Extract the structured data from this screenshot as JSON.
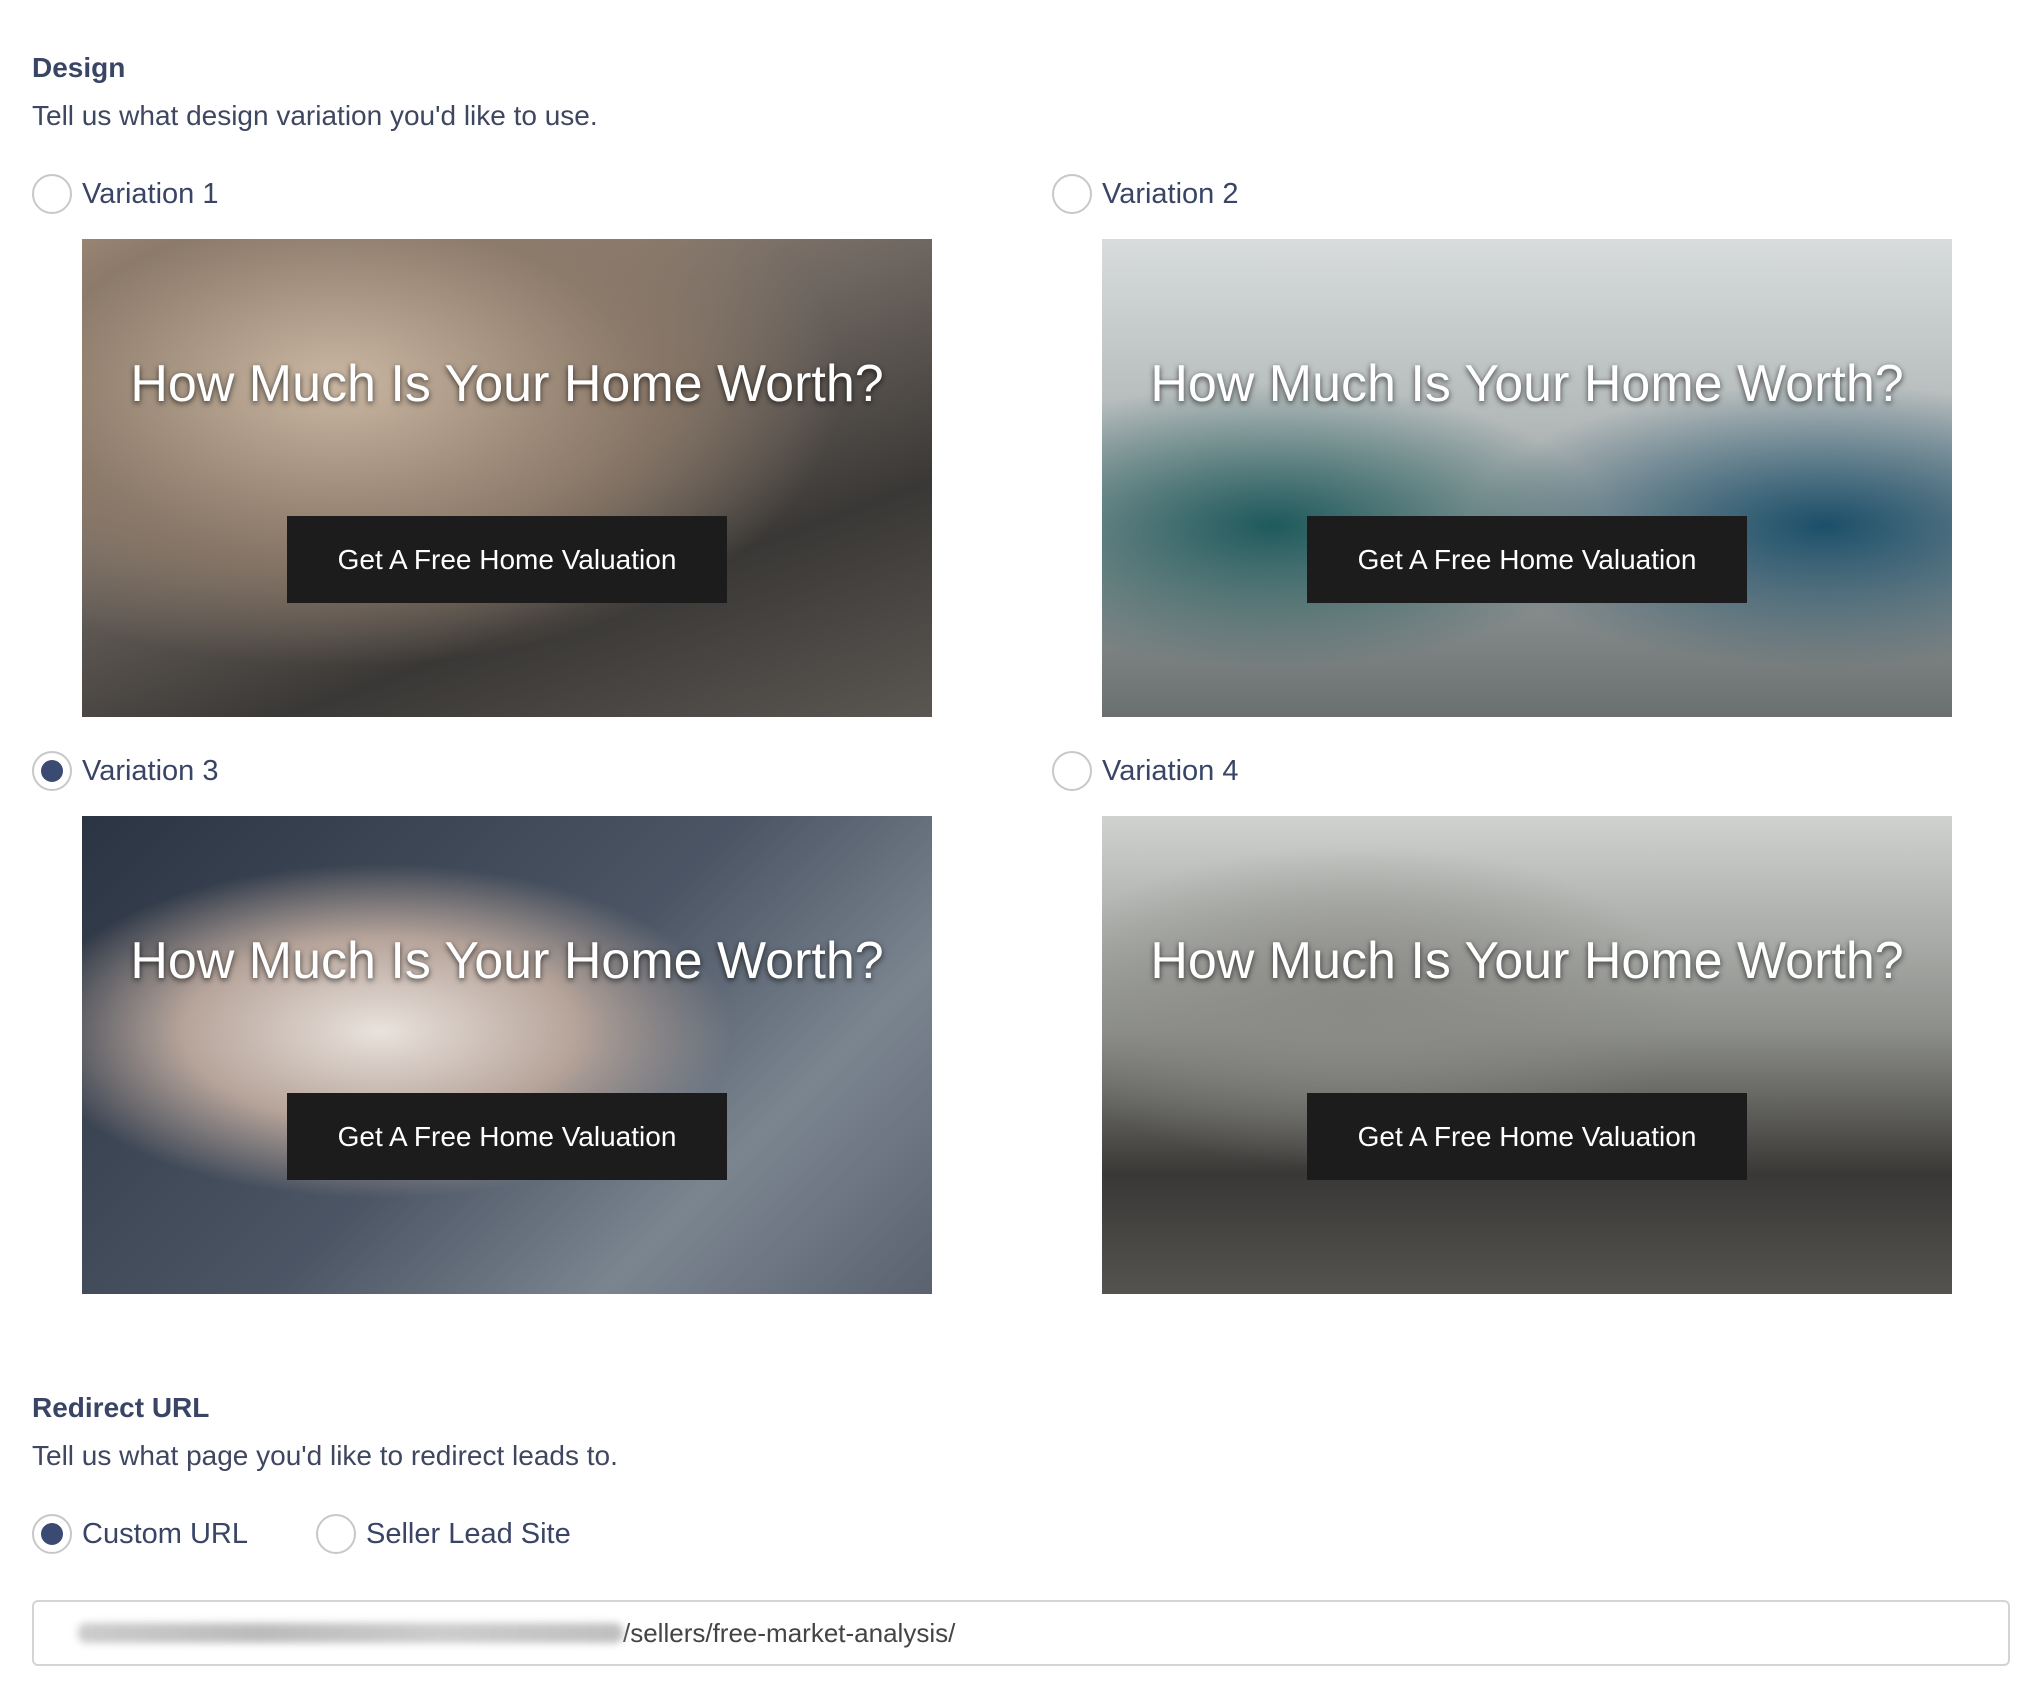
{
  "design": {
    "title": "Design",
    "subtitle": "Tell us what design variation you'd like to use.",
    "variations": [
      {
        "label": "Variation 1",
        "selected": false,
        "headline": "How Much Is Your Home Worth?",
        "button": "Get A Free Home Valuation"
      },
      {
        "label": "Variation 2",
        "selected": false,
        "headline": "How Much Is Your Home Worth?",
        "button": "Get A Free Home Valuation"
      },
      {
        "label": "Variation 3",
        "selected": true,
        "headline": "How Much Is Your Home Worth?",
        "button": "Get A Free Home Valuation"
      },
      {
        "label": "Variation 4",
        "selected": false,
        "headline": "How Much Is Your Home Worth?",
        "button": "Get A Free Home Valuation"
      }
    ]
  },
  "redirect": {
    "title": "Redirect URL",
    "subtitle": "Tell us what page you'd like to redirect leads to.",
    "options": [
      {
        "label": "Custom URL",
        "selected": true
      },
      {
        "label": "Seller Lead Site",
        "selected": false
      }
    ],
    "url_suffix": "/sellers/free-market-analysis/"
  },
  "colors": {
    "accent": "#3a4a73",
    "heading": "#3a4566",
    "button_bg": "#1c1c1c"
  }
}
